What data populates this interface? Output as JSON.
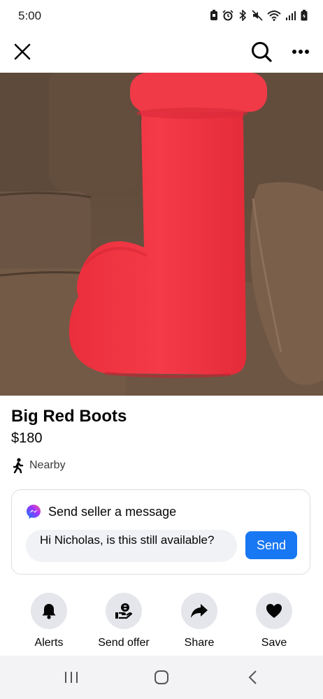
{
  "status_bar": {
    "time": "5:00",
    "icons": [
      "battery-saver-icon",
      "alarm-icon",
      "bluetooth-icon",
      "mute-icon",
      "wifi-icon",
      "signal-icon",
      "battery-icon"
    ]
  },
  "top_bar": {
    "icons": [
      "close-icon",
      "search-icon",
      "more-icon"
    ]
  },
  "photo": {
    "image_count": 2,
    "current_index": 2,
    "colors": {
      "boot": "#ef3342",
      "couch": "#6e5543"
    }
  },
  "listing": {
    "title": "Big Red Boots",
    "price": "$180",
    "location": "Nearby"
  },
  "message": {
    "heading": "Send seller a message",
    "input_value": "Hi Nicholas, is this still available?",
    "send_label": "Send"
  },
  "actions": [
    {
      "label": "Alerts",
      "icon": "bell-icon"
    },
    {
      "label": "Send offer",
      "icon": "offer-icon"
    },
    {
      "label": "Share",
      "icon": "share-icon"
    },
    {
      "label": "Save",
      "icon": "heart-icon"
    }
  ],
  "nav_bar": {
    "icons": [
      "recent-apps-icon",
      "home-icon",
      "back-icon"
    ]
  },
  "colors": {
    "accent": "#1877f2",
    "action_circle": "#e4e6eb",
    "input_bg": "#f0f2f5"
  }
}
